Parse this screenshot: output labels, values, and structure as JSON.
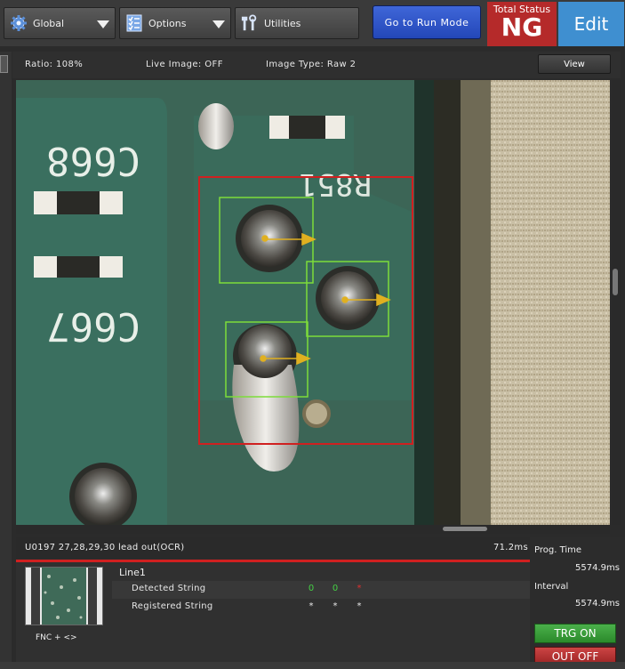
{
  "toolbar": {
    "global_label": "Global",
    "options_label": "Options",
    "utilities_label": "Utilities",
    "run_mode_label": "Go to Run Mode",
    "total_status_title": "Total Status",
    "total_status_value": "NG",
    "edit_label": "Edit"
  },
  "info_bar": {
    "ratio": "Ratio: 108%",
    "live_image": "Live Image: OFF",
    "image_type": "Image Type: Raw 2",
    "view_label": "View"
  },
  "board": {
    "silkscreen": [
      "C668",
      "R851",
      "C667"
    ]
  },
  "result": {
    "tool_text": "U0197 27,28,29,30 lead out(OCR)",
    "time": "71.2ms",
    "line_label": "Line1",
    "fnc_label": "FNC + <>",
    "rows": [
      {
        "label": "Detected String",
        "chars": [
          "0",
          "0",
          "*"
        ],
        "colors": [
          "#45d045",
          "#45d045",
          "#e03030"
        ]
      },
      {
        "label": "Registered String",
        "chars": [
          "*",
          "*",
          "*"
        ],
        "colors": [
          "#e6e6e6",
          "#e6e6e6",
          "#e6e6e6"
        ]
      }
    ]
  },
  "right_panel": {
    "prog_time_label": "Prog.  Time",
    "prog_time_value": "5574.9ms",
    "interval_label": "Interval",
    "interval_value": "5574.9ms",
    "trg_label": "TRG ON",
    "out_label": "OUT OFF"
  },
  "colors": {
    "ng": "#b52a2a",
    "edit": "#3f8fd0",
    "run_mode": "#2347b8",
    "roi_outer": "#d02020",
    "roi_inner": "#7ddc3a",
    "arrow": "#e0b020"
  },
  "icons": {
    "global": "gear-icon",
    "options": "checklist-icon",
    "utilities": "tools-icon"
  }
}
